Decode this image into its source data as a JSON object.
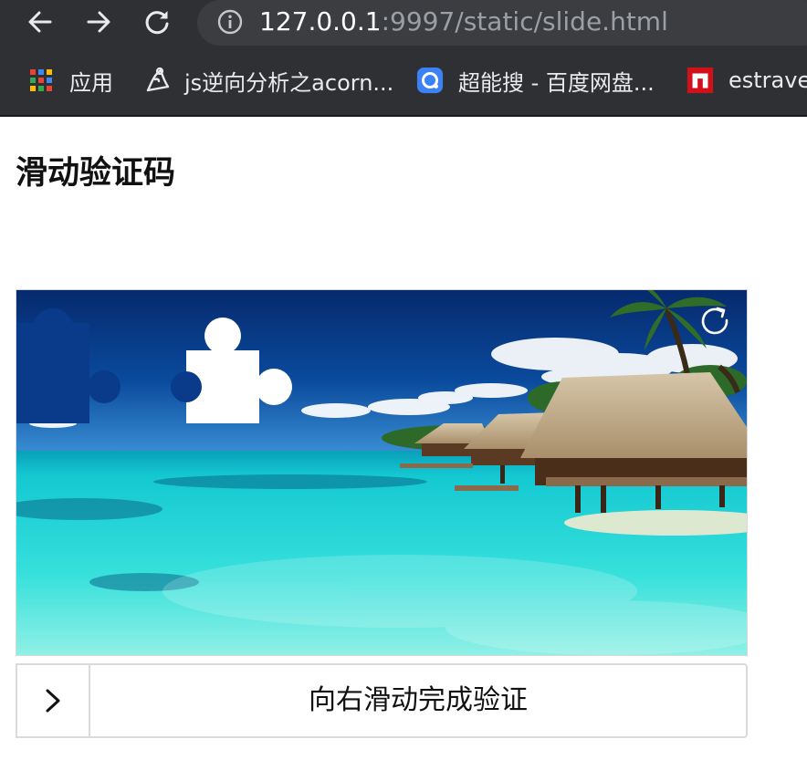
{
  "browser": {
    "url_host": "127.0.0.1",
    "url_path": ":9997/static/slide.html",
    "icons": {
      "back": "arrow-left-icon",
      "forward": "arrow-right-icon",
      "reload": "reload-icon",
      "site_info": "info-icon"
    },
    "bookmarks": [
      {
        "label": "应用",
        "icon": "apps-grid-icon"
      },
      {
        "label": "js逆向分析之acorn...",
        "icon": "pen-nib-icon"
      },
      {
        "label": "超能搜 - 百度网盘...",
        "icon": "blue-search-icon"
      },
      {
        "label": "estrave",
        "icon": "red-n-icon"
      }
    ]
  },
  "page": {
    "title": "滑动验证码"
  },
  "captcha": {
    "refresh_icon": "refresh-icon",
    "slider_text": "向右滑动完成验证",
    "handle_icon": "chevron-right-icon",
    "progress": 0
  },
  "colors": {
    "browser_bg": "#2f3033",
    "url_bar_bg": "#3c3d40",
    "url_path": "#9aa0a6",
    "border": "#dadada"
  }
}
